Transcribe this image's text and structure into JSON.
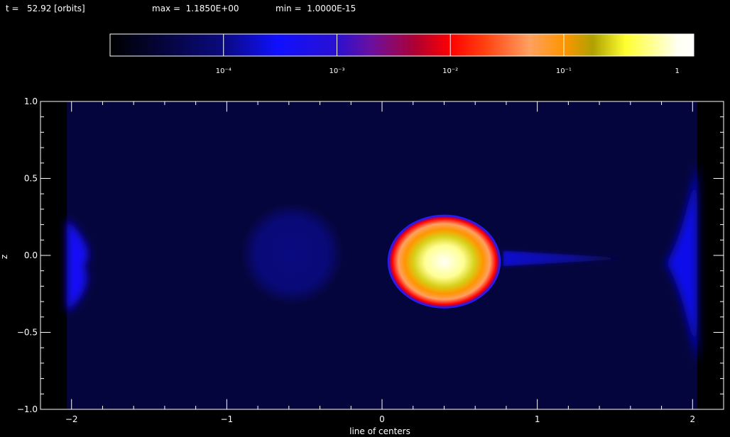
{
  "header": {
    "time_text": "t =   52.92 [orbits]",
    "max_text": "max =  1.1850E+00",
    "min_text": "min =  1.0000E-15"
  },
  "colorbar": {
    "ticks": [
      {
        "label": "10⁻⁴",
        "value": 0.0001
      },
      {
        "label": "10⁻³",
        "value": 0.001
      },
      {
        "label": "10⁻²",
        "value": 0.01
      },
      {
        "label": "10⁻¹",
        "value": 0.1
      },
      {
        "label": "1",
        "value": 1
      }
    ],
    "stops": [
      {
        "v": 1e-05,
        "color": "#000000"
      },
      {
        "v": 0.0001,
        "color": "#0a0a80"
      },
      {
        "v": 0.0003,
        "color": "#1010ff"
      },
      {
        "v": 0.001,
        "color": "#2a10d0"
      },
      {
        "v": 0.002,
        "color": "#6a10a0"
      },
      {
        "v": 0.005,
        "color": "#b00030"
      },
      {
        "v": 0.01,
        "color": "#ff0000"
      },
      {
        "v": 0.02,
        "color": "#ff4010"
      },
      {
        "v": 0.05,
        "color": "#ffa060"
      },
      {
        "v": 0.1,
        "color": "#ff9500"
      },
      {
        "v": 0.18,
        "color": "#b0a000"
      },
      {
        "v": 0.35,
        "color": "#ffff30"
      },
      {
        "v": 1.0,
        "color": "#fffff0"
      },
      {
        "v": 1.4,
        "color": "#ffffff"
      }
    ]
  },
  "chart_data": {
    "type": "heatmap",
    "title": "",
    "xlabel": "line of centers",
    "ylabel": "z",
    "xlim": [
      -2.2,
      2.2
    ],
    "ylim": [
      -1.0,
      1.0
    ],
    "x_ticks": [
      -2,
      -1,
      0,
      1,
      2
    ],
    "y_ticks": [
      -1.0,
      -0.5,
      0.0,
      0.5,
      1.0
    ],
    "x_tick_labels": [
      "−2",
      "−1",
      "0",
      "1",
      "2"
    ],
    "y_tick_labels": [
      "−1.0",
      "−0.5",
      "0.0",
      "0.5",
      "1.0"
    ],
    "field": {
      "value_min": 1e-15,
      "value_max": 1.185,
      "background_value": 3e-05,
      "domain_x": [
        -2.03,
        2.03
      ],
      "features": [
        {
          "name": "primary-star",
          "shape": "ellipse",
          "center": [
            0.4,
            -0.04
          ],
          "radius": [
            0.36,
            0.3
          ],
          "profile": [
            [
              0.0,
              1.185
            ],
            [
              0.35,
              0.6
            ],
            [
              0.55,
              0.25
            ],
            [
              0.7,
              0.1
            ],
            [
              0.82,
              0.05
            ],
            [
              0.93,
              0.01
            ],
            [
              1.0,
              0.0007
            ]
          ]
        },
        {
          "name": "secondary-lobe",
          "shape": "ellipse",
          "center": [
            -0.58,
            0.01
          ],
          "radius": [
            0.33,
            0.33
          ],
          "value": 0.0001
        },
        {
          "name": "accretion-stream",
          "shape": "taper",
          "x_range": [
            0.78,
            1.55
          ],
          "center_y": -0.02,
          "half_height": [
            0.05,
            0.005
          ],
          "value": 0.0002
        },
        {
          "name": "left-boundary-outflow",
          "shape": "edge",
          "x_range": [
            -2.03,
            -1.85
          ],
          "y_range": [
            -0.37,
            0.24
          ],
          "value": 0.00035
        },
        {
          "name": "right-boundary-outflow",
          "shape": "edge",
          "x_range": [
            1.85,
            2.03
          ],
          "y_range": [
            -0.7,
            0.6
          ],
          "value": 0.00025
        }
      ]
    }
  }
}
